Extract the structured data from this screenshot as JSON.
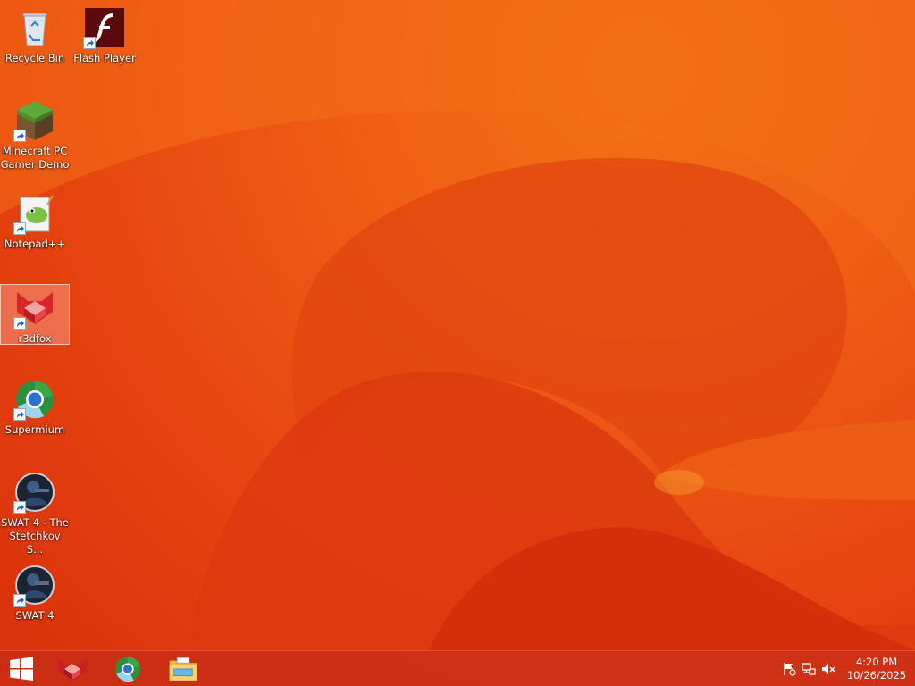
{
  "desktop": {
    "icons": [
      {
        "label": "Recycle Bin"
      },
      {
        "label": "Flash Player"
      },
      {
        "label": "Minecraft PC Gamer Demo"
      },
      {
        "label": "Notepad++"
      },
      {
        "label": "r3dfox"
      },
      {
        "label": "Supermium"
      },
      {
        "label": "SWAT 4 - The Stetchkov S..."
      },
      {
        "label": "SWAT 4"
      }
    ],
    "selected": "r3dfox"
  },
  "taskbar": {
    "start": "windows-logo-icon",
    "pinned": [
      "r3dfox-icon",
      "supermium-icon",
      "file-explorer-icon"
    ],
    "tray": {
      "icons": [
        "action-center-flag-icon",
        "network-icon",
        "volume-muted-icon"
      ],
      "time": "4:20 PM",
      "date": "10/26/2025"
    }
  },
  "colors": {
    "wallpaper_base": "#e84a12",
    "wallpaper_light": "#f47216",
    "taskbar": "#c82d14"
  }
}
